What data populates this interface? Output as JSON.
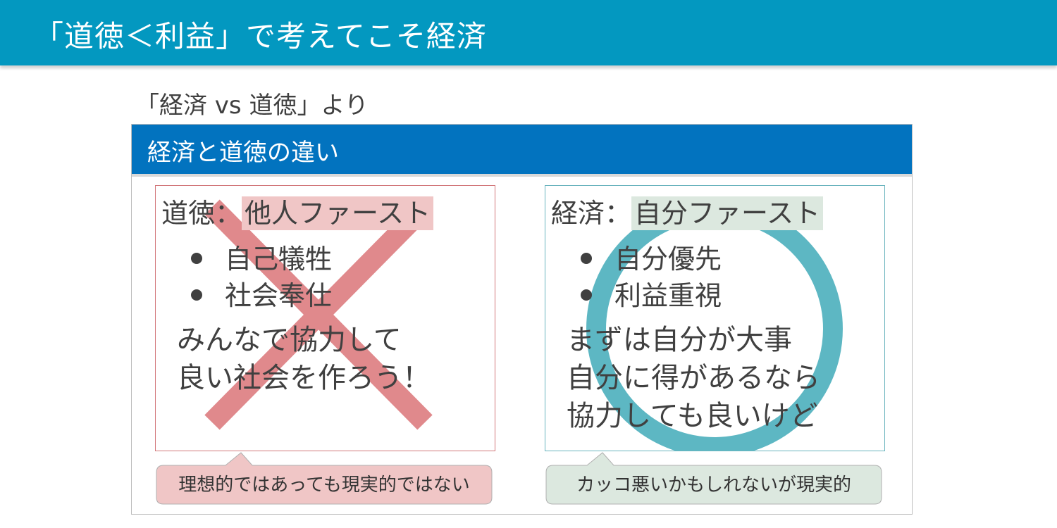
{
  "header": {
    "title": "「道徳＜利益」で考えてこそ経済"
  },
  "source": {
    "text": "「経済 vs 道徳」より"
  },
  "slide": {
    "title": "経済と道徳の違い",
    "left_panel": {
      "label": "道徳：",
      "highlight": "他人ファースト",
      "bullets": [
        "自己犠牲",
        "社会奉仕"
      ],
      "body": [
        "みんなで協力して",
        "良い社会を作ろう！"
      ],
      "mark": "cross-mark"
    },
    "right_panel": {
      "label": "経済：",
      "highlight": "自分ファースト",
      "bullets": [
        "自分優先",
        "利益重視"
      ],
      "body": [
        "まずは自分が大事",
        "自分に得があるなら",
        "協力しても良いけど"
      ],
      "mark": "circle-mark"
    },
    "left_callout": {
      "text": "理想的ではあっても現実的ではない"
    },
    "right_callout": {
      "text": "カッコ悪いかもしれないが現実的"
    }
  },
  "colors": {
    "header_bg": "#0398c0",
    "slide_bar_bg": "#0273bf",
    "cross": "#e0898c",
    "circle": "#5db7c3",
    "left_highlight": "#f0c6c6",
    "right_highlight": "#dce8df"
  }
}
